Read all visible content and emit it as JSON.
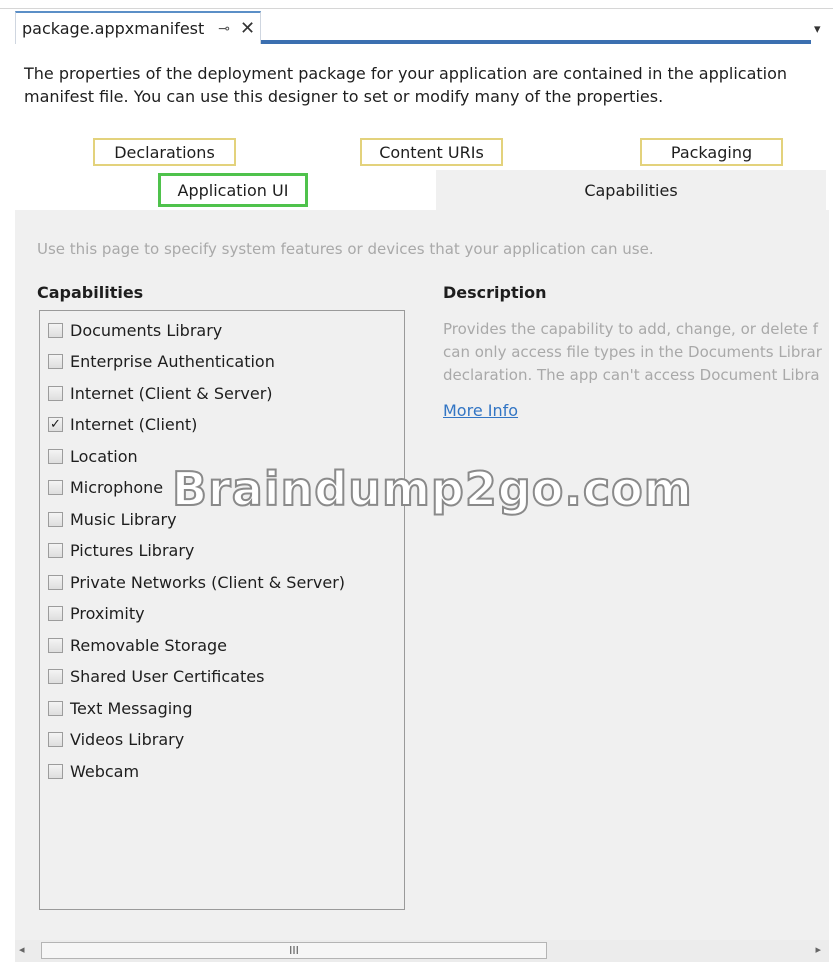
{
  "document_tab": {
    "title": "package.appxmanifest",
    "pin_icon": "pin-icon",
    "pin_glyph": "⊸",
    "close_icon": "close-icon",
    "close_glyph": "✕",
    "dropdown_glyph": "▾"
  },
  "intro": "The properties of the deployment package for your application are contained in the application manifest file. You can use this designer to set or modify many of the properties.",
  "section_tabs": {
    "declarations": "Declarations",
    "content_uris": "Content URIs",
    "packaging": "Packaging",
    "application_ui": "Application UI",
    "capabilities": "Capabilities"
  },
  "hint": "Use this page to specify system features or devices that your application can use.",
  "capabilities": {
    "header": "Capabilities",
    "items": [
      {
        "label": "Documents Library",
        "checked": false
      },
      {
        "label": "Enterprise Authentication",
        "checked": false
      },
      {
        "label": "Internet (Client & Server)",
        "checked": false
      },
      {
        "label": "Internet (Client)",
        "checked": true
      },
      {
        "label": "Location",
        "checked": false
      },
      {
        "label": "Microphone",
        "checked": false
      },
      {
        "label": "Music Library",
        "checked": false
      },
      {
        "label": "Pictures Library",
        "checked": false
      },
      {
        "label": "Private Networks (Client & Server)",
        "checked": false
      },
      {
        "label": "Proximity",
        "checked": false
      },
      {
        "label": "Removable Storage",
        "checked": false
      },
      {
        "label": "Shared User Certificates",
        "checked": false
      },
      {
        "label": "Text Messaging",
        "checked": false
      },
      {
        "label": "Videos Library",
        "checked": false
      },
      {
        "label": "Webcam",
        "checked": false
      }
    ]
  },
  "description": {
    "header": "Description",
    "lines": [
      "Provides the capability to add, change, or delete f",
      "can only access file types in the Documents Librar",
      "declaration. The app can't access Document Libra"
    ],
    "more_info": "More Info"
  },
  "watermark": "Braindump2go.com",
  "scrollbar": {
    "left_arrow": "◂",
    "right_arrow": "▸",
    "grip": "III"
  }
}
